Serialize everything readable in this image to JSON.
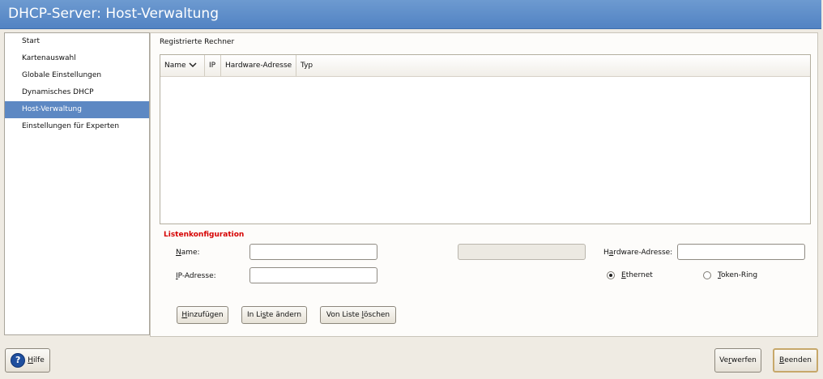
{
  "window": {
    "title": "DHCP-Server: Host-Verwaltung"
  },
  "sidebar": {
    "items": [
      {
        "label": "Start"
      },
      {
        "label": "Kartenauswahl"
      },
      {
        "label": "Globale Einstellungen"
      },
      {
        "label": "Dynamisches DHCP"
      },
      {
        "label": "Host-Verwaltung",
        "selected": true
      },
      {
        "label": "Einstellungen für Experten"
      }
    ]
  },
  "hosts": {
    "section_label": "Registrierte Rechner",
    "columns": [
      "Name",
      "IP",
      "Hardware-Adresse",
      "Typ"
    ],
    "sort_icon": "chevron-down-icon",
    "rows": []
  },
  "config": {
    "title": "Listenkonfiguration",
    "name_label": "Name:",
    "name_value": "",
    "ip_label": "IP-Adresse:",
    "ip_value": "",
    "hw_label": "Hardware-Adresse:",
    "hw_value": "",
    "disabled_value": "",
    "radio_ethernet": "Ethernet",
    "radio_tokenring": "Token-Ring",
    "selected_type": "Ethernet",
    "btn_add": "Hinzufügen",
    "btn_change": "In Liste ändern",
    "btn_delete": "Von Liste löschen"
  },
  "footer": {
    "help": "Hilfe",
    "help_icon": "help-icon",
    "discard": "Verwerfen",
    "finish": "Beenden"
  },
  "colors": {
    "titlebar": "#5a8bc9",
    "selection": "#5d88c3",
    "section_title": "#d60000"
  }
}
